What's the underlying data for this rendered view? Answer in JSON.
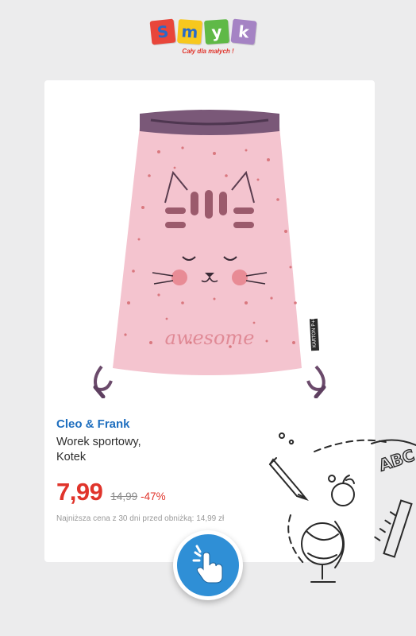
{
  "brand_logo": {
    "letters": [
      "S",
      "m",
      "y",
      "k"
    ],
    "tagline": "Cały dla małych !"
  },
  "product": {
    "brand": "Cleo & Frank",
    "name": "Worek sportowy,\nKotek",
    "price": "7,99",
    "old_price": "14,99",
    "discount": "-47%",
    "lowest_price_note": "Najniższa cena z 30 dni przed obniżką: 14,99 zł",
    "image_print_text": "awesome",
    "image_tag_text": "KARTON P+P"
  },
  "doodle_text": "ABC",
  "tap_button": {
    "icon": "tap-hand-icon"
  },
  "colors": {
    "price_red": "#e0342b",
    "brand_blue": "#1f6fbf",
    "button_blue": "#2f8fd6",
    "bag_pink": "#f4c4cf"
  }
}
